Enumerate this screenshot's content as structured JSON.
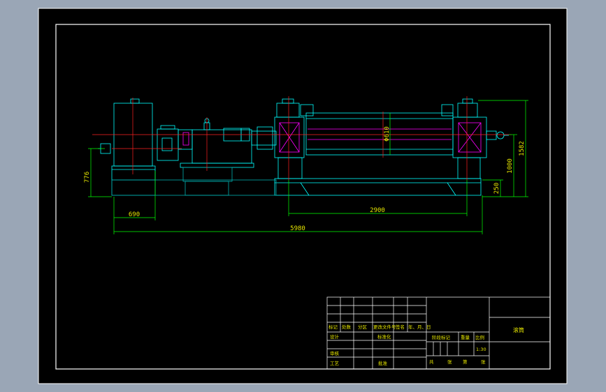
{
  "colors": {
    "background_outer": "#9aa6b6",
    "paper": "#000000",
    "frame": "#ffffff",
    "drawing": "#00ffff",
    "dimension": "#00ff00",
    "centerline": "#ff2020",
    "accent": "#ff00ff",
    "text": "#e6e600"
  },
  "dimensions": {
    "height_776": "776",
    "length_690": "690",
    "length_2900": "2900",
    "length_5980": "5980",
    "diameter": "Φ610",
    "height_1000": "1000",
    "height_1582": "1582",
    "height_250": "250"
  },
  "title_block": {
    "row_headers": [
      "标记",
      "处数",
      "分区",
      "更改文件号",
      "签名",
      "年、月、日"
    ],
    "design": "设计",
    "standardization": "标准化",
    "review": "审核",
    "process": "工艺",
    "approve": "批准",
    "stage_mark": "阶段标记",
    "weight": "重量",
    "scale": "比例",
    "scale_value": "1:30",
    "sheet_total": "共",
    "sheet_zhang": "张",
    "sheet_di": "第",
    "sheet_zhang2": "张",
    "drawing_name": "滚筒"
  }
}
